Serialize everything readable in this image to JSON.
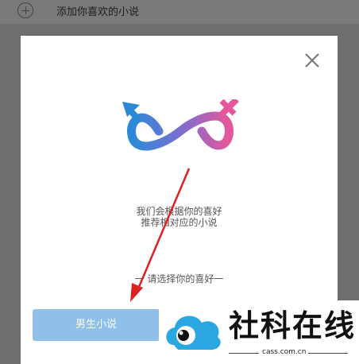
{
  "topbar": {
    "label": "添加你喜欢的小说"
  },
  "modal": {
    "description_line1": "我们会根据你的喜好",
    "description_line2": "推荐相对应的小说",
    "hint": "一 请选择你的喜好一",
    "male_button": "男生小说"
  },
  "watermark": {
    "title": "社科在线",
    "url": "cass.com.cn"
  },
  "colors": {
    "male_button": "#8fc0ea",
    "logo_blue": "#2a8ad8",
    "logo_pink": "#e5579b",
    "arrow": "#e02020"
  }
}
